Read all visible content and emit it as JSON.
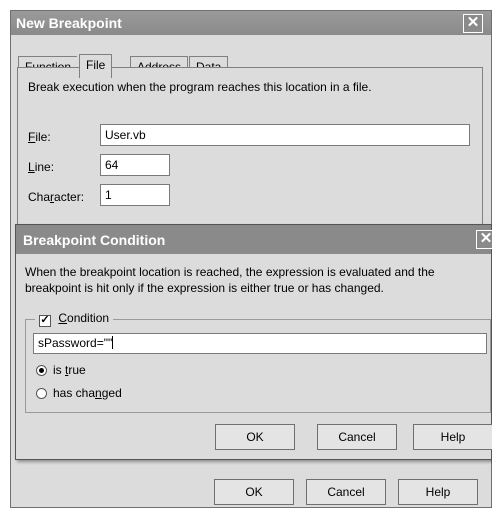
{
  "new_breakpoint": {
    "title": "New Breakpoint",
    "tabs": [
      {
        "label": "Function"
      },
      {
        "label": "File"
      },
      {
        "label": "Address"
      },
      {
        "label": "Data"
      }
    ],
    "description": "Break execution when the program reaches this location in a file.",
    "file_label": "File:",
    "file_value": "User.vb",
    "line_label": "Line:",
    "line_value": "64",
    "character_label": "Character:",
    "character_value": "1",
    "ok_label": "OK",
    "cancel_label": "Cancel",
    "help_label": "Help"
  },
  "breakpoint_condition": {
    "title": "Breakpoint Condition",
    "description_line1": "When the breakpoint location is reached, the expression is evaluated and the",
    "description_line2": "breakpoint is hit only if the expression is either true or has changed.",
    "condition_label": "Condition",
    "condition_checked": true,
    "expression_value": "sPassword=\"\"",
    "is_true_label": "is true",
    "has_changed_label": "has changed",
    "selected_option": "is true",
    "ok_label": "OK",
    "cancel_label": "Cancel",
    "help_label": "Help"
  }
}
